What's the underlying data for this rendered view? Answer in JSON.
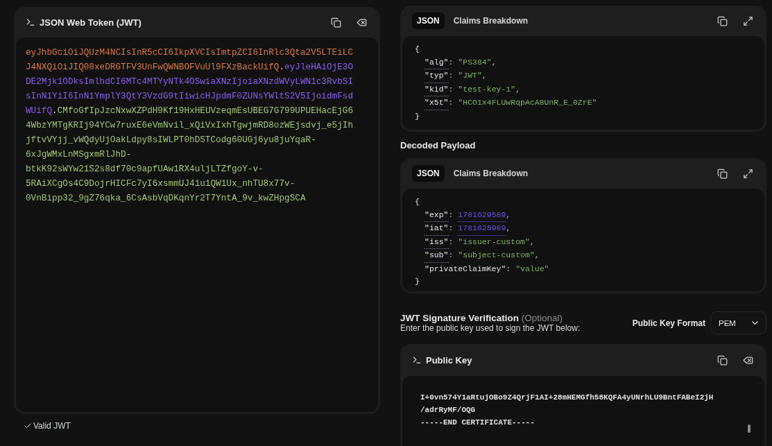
{
  "token_panel": {
    "title": "JSON Web Token (JWT)",
    "parts": [
      {
        "kind": "header",
        "text": "eyJhbGciOiJQUzM4NCIsInR5cCI6IkpXVCIsImtpZCI6InRlc3Qta2V5LTEiLCJ4NXQiOiJIQ08xeDRGTFV3UnFwQWNBOFVuUl9FXzBackUifQ"
      },
      {
        "kind": "dot",
        "text": "."
      },
      {
        "kind": "payload",
        "text": "eyJleHAiOjE3ODE2Mjk1ODksImlhdCI6MTc4MTYyNTk4OSwiaXNzIjoiaXNzdWVyLWN1c3RvbSIsInN1YiI6InN1YmplY3QtY3VzdG9tIiwicHJpdmF0ZUNsYWltS2V5IjoidmFsdWUifQ"
      },
      {
        "kind": "dot",
        "text": "."
      },
      {
        "kind": "signature",
        "text": "CMfoGfIpJzcNxwXZPdH9Kf19HxHEUVzeqmEsUBEG7G799UPUEHacEjG64WbzYMTgKRIj94YCw7ruxE6eVmNvil_xQiVxIxhTgwjmRD8ozWEjsdvj_e5jIhjftvVYjj_vWQdyUjOakLdpy8sIWLPT0hDSTCodg60UGj6yu8juYqaR-6xJgWMxLnMSgxmRlJhD-btkK92sWYw21S2s8df70c9apfUAw1RX4uljLTZfgoY-v-5RAiXCgOs4C9DojrHICFc7yI6xsmmUJ41u1QW1Ux_nhTU8x77v-0VnBipp32_9gZ76qka_6CsAsbVqDKqnYr2T7YntA_9v_kwZHpgSCA"
      }
    ],
    "status": {
      "valid": true,
      "label": "Valid JWT"
    }
  },
  "header_panel": {
    "tabs": [
      {
        "label": "JSON",
        "selected": true
      },
      {
        "label": "Claims Breakdown",
        "selected": false
      }
    ],
    "open_brace": "{",
    "close_brace": "}",
    "claims": [
      {
        "key": "\"alg\"",
        "colon": ":",
        "value": "\"PS384\"",
        "kind": "string",
        "documented": true,
        "comma": ","
      },
      {
        "key": "\"typ\"",
        "colon": ":",
        "value": "\"JWT\"",
        "kind": "string",
        "documented": true,
        "comma": ","
      },
      {
        "key": "\"kid\"",
        "colon": ":",
        "value": "\"test-key-1\"",
        "kind": "string",
        "documented": true,
        "comma": ","
      },
      {
        "key": "\"x5t\"",
        "colon": ":",
        "value": "\"HCO1x4FLUwRqpAcA8UnR_E_0ZrE\"",
        "kind": "string",
        "documented": true
      }
    ]
  },
  "payload_title": "Decoded Payload",
  "payload_panel": {
    "tabs": [
      {
        "label": "JSON",
        "selected": true
      },
      {
        "label": "Claims Breakdown",
        "selected": false
      }
    ],
    "open_brace": "{",
    "close_brace": "}",
    "claims": [
      {
        "key": "\"exp\"",
        "colon": ":",
        "value": "1781629589",
        "kind": "number",
        "documented": true,
        "comma": ","
      },
      {
        "key": "\"iat\"",
        "colon": ":",
        "value": "1781625989",
        "kind": "number",
        "documented": true,
        "comma": ","
      },
      {
        "key": "\"iss\"",
        "colon": ":",
        "value": "\"issuer-custom\"",
        "kind": "string",
        "documented": true,
        "comma": ","
      },
      {
        "key": "\"sub\"",
        "colon": ":",
        "value": "\"subject-custom\"",
        "kind": "string",
        "documented": true,
        "comma": ","
      },
      {
        "key": "\"privateClaimKey\"",
        "colon": ":",
        "value": "\"value\"",
        "kind": "string",
        "documented": false
      }
    ]
  },
  "verification": {
    "title": "JWT Signature Verification",
    "optional": "(Optional)",
    "subtitle": "Enter the public key used to sign the JWT below:",
    "format_label": "Public Key Format",
    "format_value": "PEM"
  },
  "key_panel": {
    "title": "Public Key",
    "lines": [
      "I+0vn574Y1aRtujOBo9Z4QrjF1AI+28mHEMGfh58KQFA4yUNrhLU9BntFABeI2jH",
      "/adrRyMF/OQG",
      "-----END CERTIFICATE-----"
    ]
  }
}
